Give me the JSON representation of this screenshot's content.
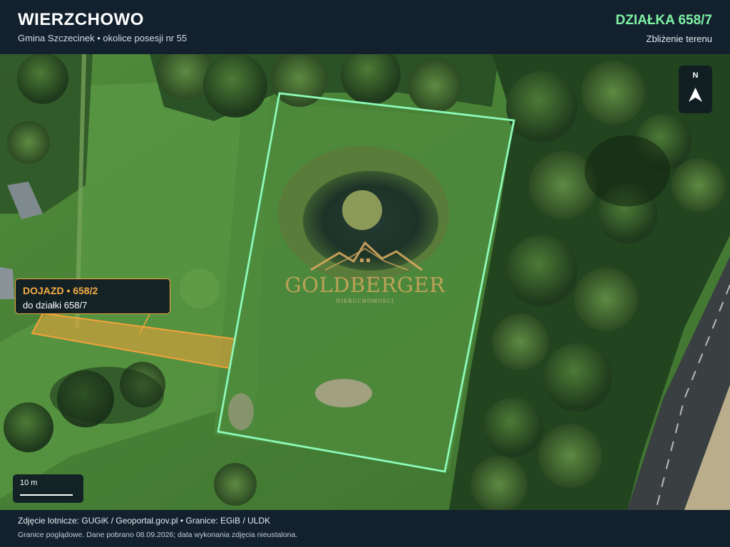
{
  "header": {
    "title": "WIERZCHOWO",
    "subtitle": "Gmina Szczecinek • okolice posesji nr 55",
    "parcel_title": "DZIAŁKA 658/7",
    "parcel_subtitle": "Zbliżenie terenu"
  },
  "north": {
    "label": "N",
    "icon": "north-arrow-icon"
  },
  "access": {
    "title": "DOJAZD • 658/2",
    "subtitle": "do działki 658/7"
  },
  "scale": {
    "label": "10 m"
  },
  "watermark": {
    "brand": "GOLDBERGER",
    "tagline": "NIERUCHOMOŚCI",
    "icon": "mountain-roof-logo-icon"
  },
  "footer": {
    "line1": "Zdjęcie lotnicze: GUGiK / Geoportal.gov.pl • Granice: EGiB / ULDK",
    "line2": "Granice poglądowe. Dane pobrano 08.09.2026; data wykonania zdjęcia nieustalona."
  },
  "colors": {
    "parcel_boundary": "#6ff0a0",
    "access_fill": "#f2a23a",
    "header_bg": "#13212e",
    "accent_green": "#7ff2a4",
    "accent_orange": "#f6ac45"
  }
}
